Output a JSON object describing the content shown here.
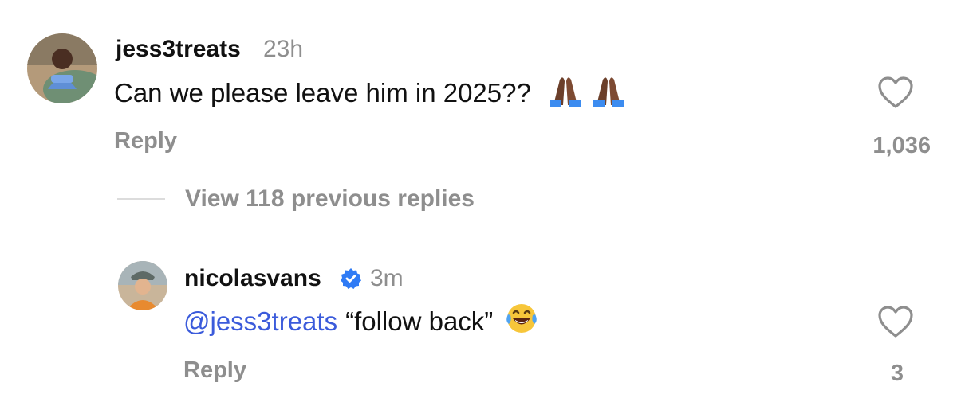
{
  "comments": [
    {
      "username": "jess3treats",
      "timestamp": "23h",
      "text": "Can we please leave him in 2025??",
      "emoji": [
        "folded-hands-dark",
        "folded-hands-dark"
      ],
      "reply_label": "Reply",
      "likes": "1,036"
    }
  ],
  "thread": {
    "view_replies_label": "View 118 previous replies"
  },
  "replies": [
    {
      "username": "nicolasvans",
      "verified": true,
      "timestamp": "3m",
      "mention": "@jess3treats",
      "text": "“follow back”",
      "emoji": [
        "face-with-tears-of-joy"
      ],
      "reply_label": "Reply",
      "likes": "3"
    }
  ],
  "colors": {
    "muted": "#8e8e8e",
    "mention": "#3b5bdb",
    "verified": "#2f7bf5"
  }
}
